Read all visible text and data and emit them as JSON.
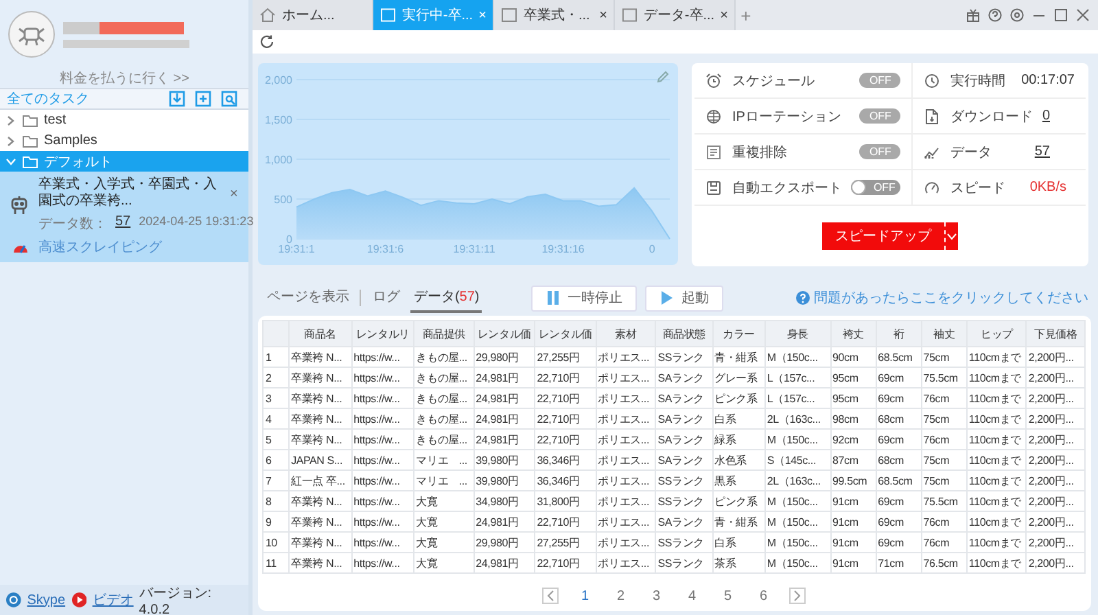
{
  "sidebar": {
    "account": {
      "pay_link": "料金を払うに行く >>"
    },
    "header": {
      "title": "全てのタスク"
    },
    "tree": [
      {
        "label": "test",
        "expanded": false,
        "selected": false
      },
      {
        "label": "Samples",
        "expanded": false,
        "selected": false
      },
      {
        "label": "デフォルト",
        "expanded": true,
        "selected": true,
        "children": [
          {
            "title": "卒業式・入学式・卒園式・入園式の卒業袴...",
            "count_label": "データ数：",
            "count": "57",
            "time": "2024-04-25 19:31:23",
            "mode": "高速スクレイピング",
            "close": "×",
            "selected": true
          }
        ]
      }
    ],
    "footer": {
      "links": [
        {
          "kind": "skype",
          "label": "Skype"
        },
        {
          "kind": "video",
          "label": "ビデオ"
        }
      ],
      "version": "バージョン: 4.0.2"
    }
  },
  "tabs": [
    {
      "kind": "home",
      "label": "ホーム...",
      "selected": false
    },
    {
      "kind": "page",
      "label": "実行中-卒...",
      "close": "×",
      "selected": true
    },
    {
      "kind": "page",
      "label": "卒業式・...",
      "close": "×",
      "selected": false
    },
    {
      "kind": "page",
      "label": "データ-卒...",
      "close": "×",
      "selected": false
    }
  ],
  "new_tab": "+",
  "chart": {
    "chart_data": {
      "type": "area",
      "categories": [
        "19:31:1",
        null,
        null,
        null,
        null,
        "19:31:6",
        null,
        null,
        null,
        null,
        "19:31:11",
        null,
        null,
        null,
        null,
        "19:31:16",
        null,
        null,
        null,
        null,
        "0",
        null
      ],
      "series": [
        {
          "color": "#8ec8f2",
          "values": [
            400,
            500,
            580,
            620,
            540,
            600,
            520,
            420,
            480,
            450,
            440,
            500,
            440,
            530,
            560,
            480,
            480,
            410,
            430,
            640,
            350,
            0
          ]
        }
      ],
      "ylim": [
        0,
        2000
      ],
      "grid": true,
      "yticks": [
        {
          "value": 0,
          "label": "0"
        },
        {
          "value": 500,
          "label": "500"
        },
        {
          "value": 1000,
          "label": "1,000"
        },
        {
          "value": 1500,
          "label": "1,500"
        },
        {
          "value": 2000,
          "label": "2,000"
        }
      ]
    }
  },
  "stats": {
    "left": [
      {
        "kind": "toggle",
        "label": "スケジュール",
        "value": "OFF",
        "on": false,
        "disabled": true
      },
      {
        "kind": "toggle",
        "label": "IPローテーション",
        "value": "OFF",
        "on": false,
        "disabled": true
      },
      {
        "kind": "toggle",
        "label": "重複排除",
        "value": "OFF",
        "on": false,
        "disabled": true
      },
      {
        "kind": "toggle",
        "label": "自動エクスポート",
        "value": "OFF",
        "on": false,
        "disabled": false
      }
    ],
    "right": [
      {
        "kind": "text",
        "label": "実行時間",
        "value": "00:17:07"
      },
      {
        "kind": "link",
        "label": "ダウンロード",
        "value": "0"
      },
      {
        "kind": "link",
        "label": "データ",
        "value": "57"
      },
      {
        "kind": "alert",
        "label": "スピード",
        "value": "0KB/s"
      }
    ],
    "speedup": "スピードアップ"
  },
  "view_tabs": [
    {
      "label": "ページを表示",
      "selected": false
    },
    {
      "label": "ログ",
      "selected": false
    },
    {
      "label": "データ(",
      "count": "57",
      "suffix": ")",
      "selected": true
    }
  ],
  "controls": [
    {
      "kind": "pause",
      "label": "一時停止"
    },
    {
      "kind": "play",
      "label": "起動"
    }
  ],
  "help": "問題があったらここをクリックしてください",
  "table": {
    "columns": [
      "",
      "商品名",
      "レンタルリ",
      "商品提供",
      "レンタル価",
      "レンタル価",
      "素材",
      "商品状態",
      "カラー",
      "身長",
      "袴丈",
      "裄",
      "袖丈",
      "ヒップ",
      "下見価格"
    ],
    "rows": [
      [
        "1",
        "卒業袴 N...",
        "https://w...",
        "きもの屋...",
        "29,980円",
        "27,255円",
        "ポリエス...",
        "SSランク",
        "青・紺系",
        "M（150c...",
        "90cm",
        "68.5cm",
        "75cm",
        "110cmまで",
        "2,200円..."
      ],
      [
        "2",
        "卒業袴 N...",
        "https://w...",
        "きもの屋...",
        "24,981円",
        "22,710円",
        "ポリエス...",
        "SAランク",
        "グレー系",
        "L（157c...",
        "95cm",
        "69cm",
        "75.5cm",
        "110cmまで",
        "2,200円..."
      ],
      [
        "3",
        "卒業袴 N...",
        "https://w...",
        "きもの屋...",
        "24,981円",
        "22,710円",
        "ポリエス...",
        "SAランク",
        "ピンク系",
        "L（157c...",
        "95cm",
        "69cm",
        "76cm",
        "110cmまで",
        "2,200円..."
      ],
      [
        "4",
        "卒業袴 N...",
        "https://w...",
        "きもの屋...",
        "24,981円",
        "22,710円",
        "ポリエス...",
        "SAランク",
        "白系",
        "2L（163c...",
        "98cm",
        "68cm",
        "75cm",
        "110cmまで",
        "2,200円..."
      ],
      [
        "5",
        "卒業袴 N...",
        "https://w...",
        "きもの屋...",
        "24,981円",
        "22,710円",
        "ポリエス...",
        "SAランク",
        "緑系",
        "M（150c...",
        "92cm",
        "69cm",
        "76cm",
        "110cmまで",
        "2,200円..."
      ],
      [
        "6",
        "JAPAN S...",
        "https://w...",
        "マリエ　...",
        "39,980円",
        "36,346円",
        "ポリエス...",
        "SAランク",
        "水色系",
        "S（145c...",
        "87cm",
        "68cm",
        "75cm",
        "110cmまで",
        "2,200円..."
      ],
      [
        "7",
        "紅一点 卒...",
        "https://w...",
        "マリエ　...",
        "39,980円",
        "36,346円",
        "ポリエス...",
        "SSランク",
        "黒系",
        "2L（163c...",
        "99.5cm",
        "68.5cm",
        "75cm",
        "110cmまで",
        "2,200円..."
      ],
      [
        "8",
        "卒業袴 N...",
        "https://w...",
        "大寛",
        "34,980円",
        "31,800円",
        "ポリエス...",
        "SSランク",
        "ピンク系",
        "M（150c...",
        "91cm",
        "69cm",
        "75.5cm",
        "110cmまで",
        "2,200円..."
      ],
      [
        "9",
        "卒業袴 N...",
        "https://w...",
        "大寛",
        "24,981円",
        "22,710円",
        "ポリエス...",
        "SAランク",
        "青・紺系",
        "M（150c...",
        "91cm",
        "69cm",
        "76cm",
        "110cmまで",
        "2,200円..."
      ],
      [
        "10",
        "卒業袴 N...",
        "https://w...",
        "大寛",
        "29,980円",
        "27,255円",
        "ポリエス...",
        "SSランク",
        "白系",
        "M（150c...",
        "91cm",
        "69cm",
        "76cm",
        "110cmまで",
        "2,200円..."
      ],
      [
        "11",
        "卒業袴 N...",
        "https://w...",
        "大寛",
        "24,981円",
        "22,710円",
        "ポリエス...",
        "SSランク",
        "茶系",
        "M（150c...",
        "91cm",
        "71cm",
        "76.5cm",
        "110cmまで",
        "2,200円..."
      ]
    ]
  },
  "pagination": [
    {
      "label": "1",
      "selected": true
    },
    {
      "label": "2",
      "selected": false
    },
    {
      "label": "3",
      "selected": false
    },
    {
      "label": "4",
      "selected": false
    },
    {
      "label": "5",
      "selected": false
    },
    {
      "label": "6",
      "selected": false
    }
  ]
}
